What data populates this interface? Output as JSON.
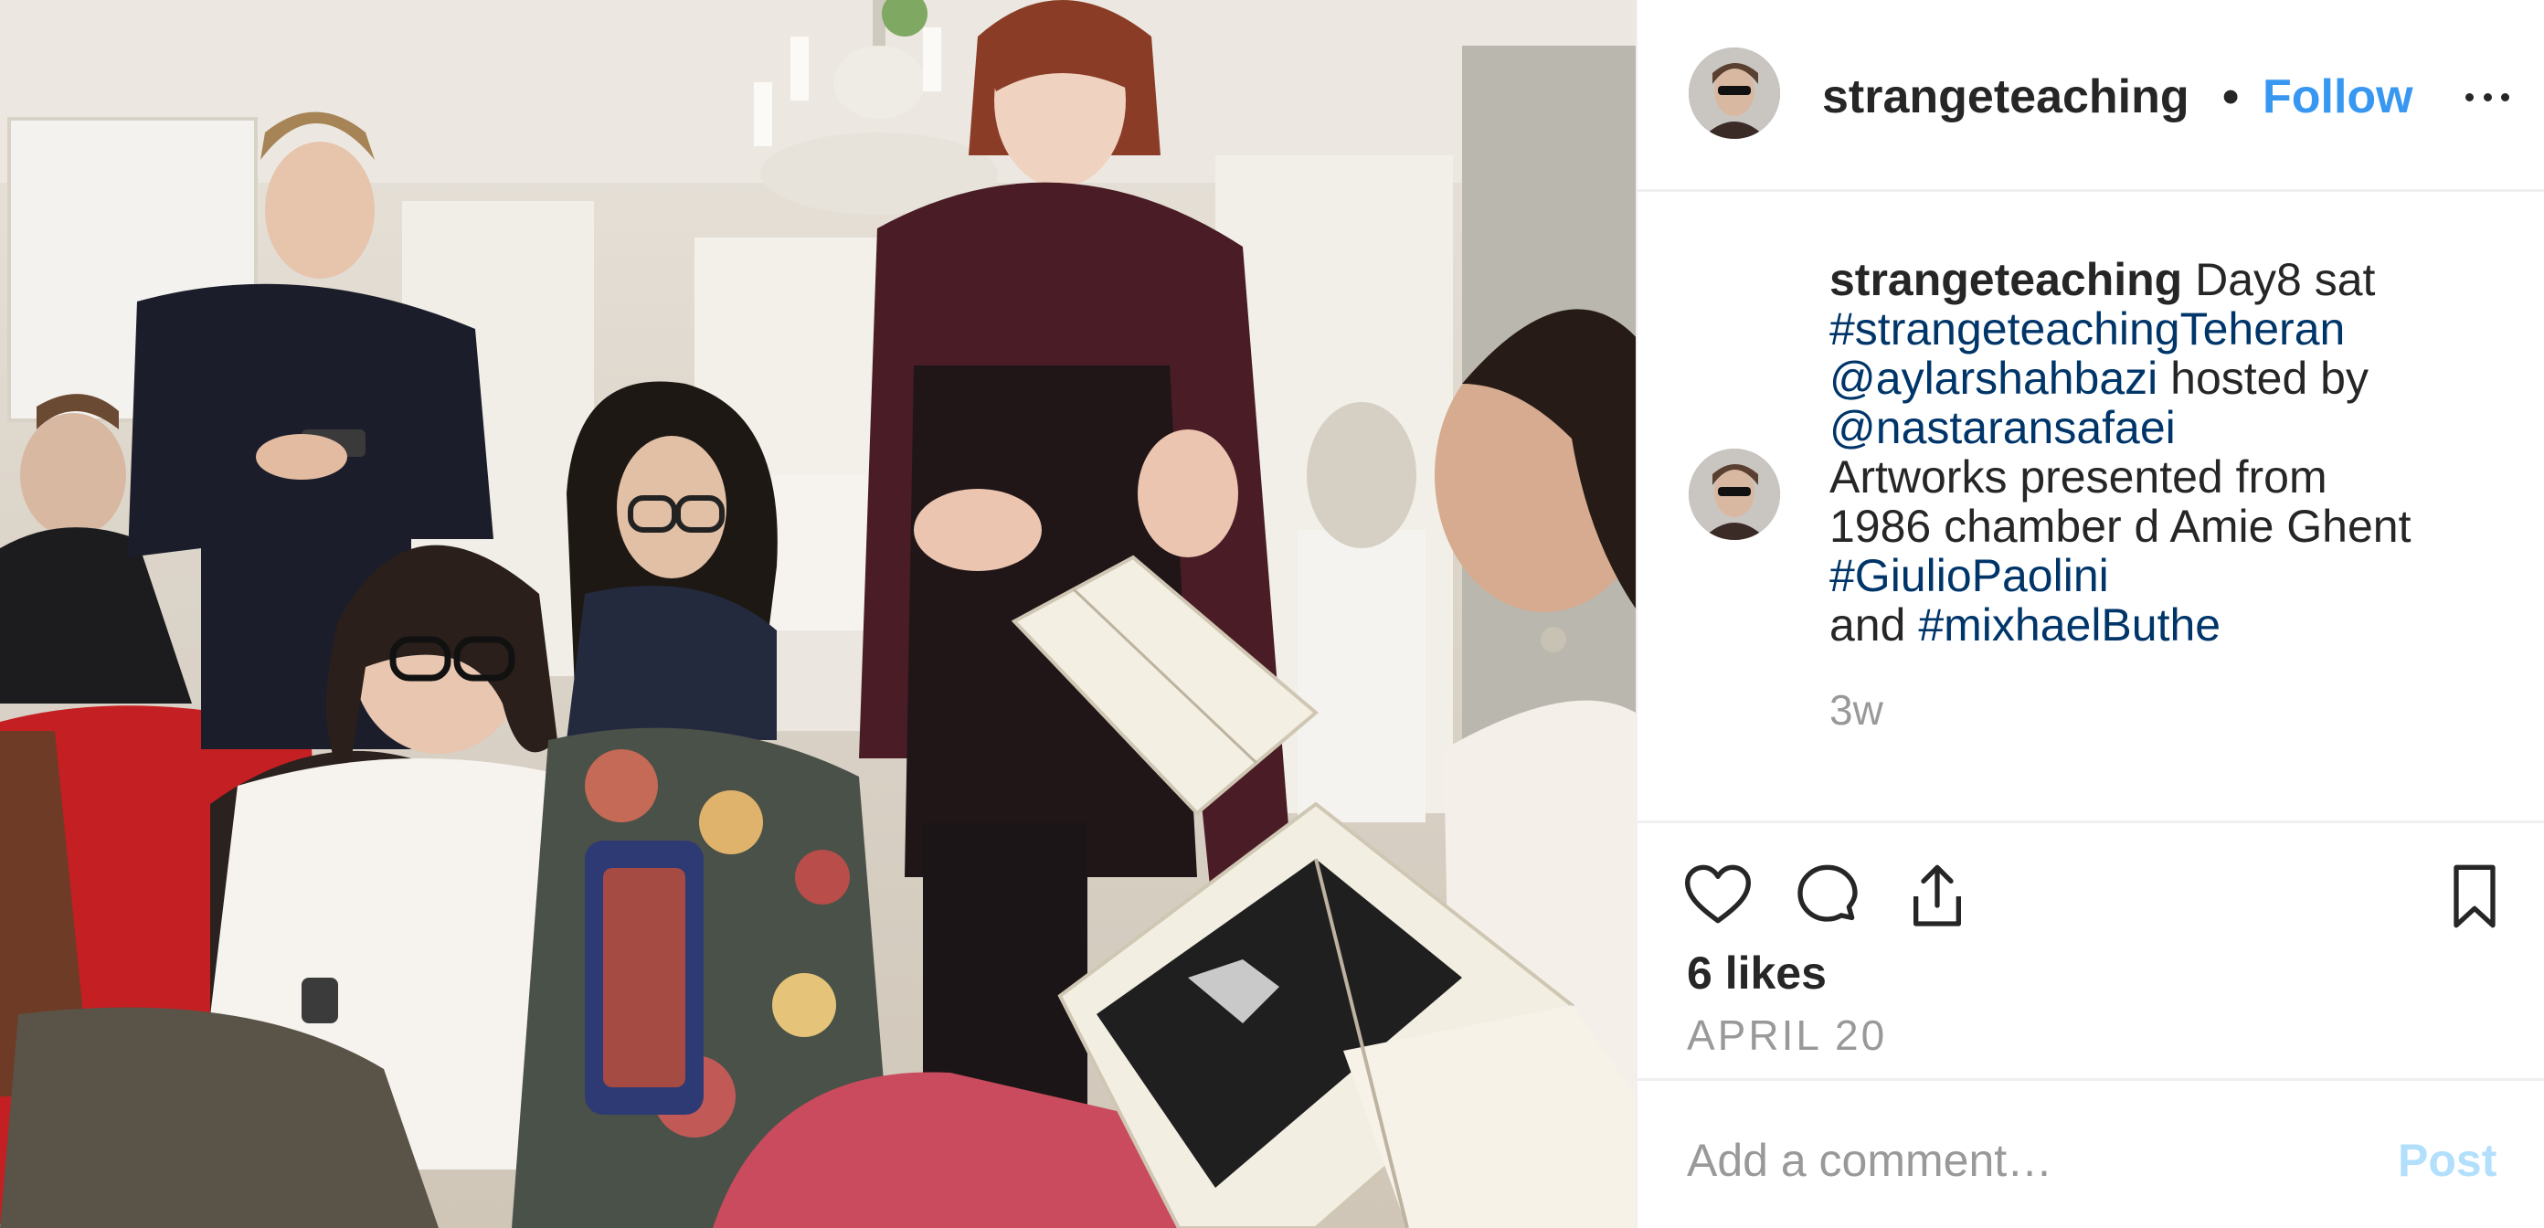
{
  "post": {
    "username": "strangeteaching",
    "header_username": "strangeteaching",
    "separator": "•",
    "follow_label": "Follow",
    "more_icon": "more-horizontal-icon",
    "photo_description_icon": "post-photo"
  },
  "caption": {
    "username": "strangeteaching",
    "lines": [
      [
        {
          "t": "text",
          "v": " Day8 sat"
        }
      ],
      [
        {
          "t": "tag",
          "v": "#strangeteachingTeheran"
        }
      ],
      [
        {
          "t": "tag",
          "v": "@aylarshahbazi"
        },
        {
          "t": "text",
          "v": " hosted by"
        }
      ],
      [
        {
          "t": "tag",
          "v": "@nastaransafaei"
        }
      ],
      [
        {
          "t": "text",
          "v": "Artworks presented from"
        }
      ],
      [
        {
          "t": "text",
          "v": "1986 chamber d Amie Ghent"
        }
      ],
      [
        {
          "t": "tag",
          "v": "#GiulioPaolini"
        }
      ],
      [
        {
          "t": "text",
          "v": "and "
        },
        {
          "t": "tag",
          "v": "#mixhaelButhe"
        }
      ]
    ],
    "time_ago": "3w"
  },
  "actions": {
    "like_icon": "heart-icon",
    "comment_icon": "comment-icon",
    "share_icon": "share-icon",
    "save_icon": "bookmark-icon",
    "likes_label": "6 likes",
    "date": "APRIL 20"
  },
  "comment": {
    "placeholder": "Add a comment…",
    "post_label": "Post"
  },
  "colors": {
    "link_blue": "#3897f0",
    "tag_navy": "#003569",
    "muted_gray": "#999999",
    "text_dark": "#262626",
    "post_disabled": "#b2dffc",
    "divider": "#efefef"
  }
}
